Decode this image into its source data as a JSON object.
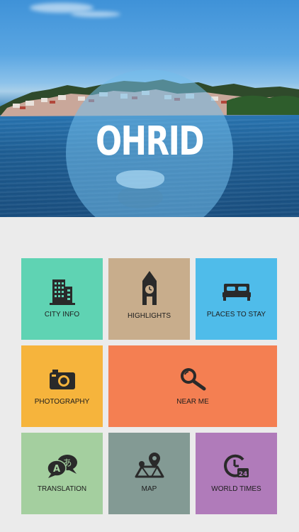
{
  "hero": {
    "title": "OHRID"
  },
  "tiles": [
    {
      "label": "CITY INFO",
      "icon": "building-icon",
      "color": "#5fd3b3"
    },
    {
      "label": "HIGHLIGHTS",
      "icon": "clock-tower-icon",
      "color": "#c8ad8c"
    },
    {
      "label": "PLACES TO STAY",
      "icon": "bed-icon",
      "color": "#4fbcea"
    },
    {
      "label": "PHOTOGRAPHY",
      "icon": "camera-icon",
      "color": "#f6b43c"
    },
    {
      "label": "NEAR ME",
      "icon": "magnifier-icon",
      "color": "#f47f52"
    },
    {
      "label": "TRANSLATION",
      "icon": "translation-bubbles-icon",
      "color": "#a4cf9f"
    },
    {
      "label": "MAP",
      "icon": "map-pin-icon",
      "color": "#839a94"
    },
    {
      "label": "WORLD TIMES",
      "icon": "clock-24-icon",
      "color": "#b07bba"
    }
  ]
}
